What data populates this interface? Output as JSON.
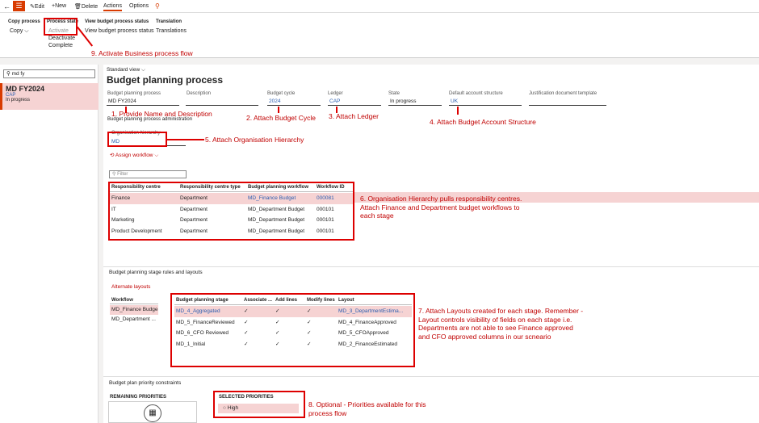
{
  "toolbar": {
    "edit": "Edit",
    "new": "New",
    "delete": "Delete",
    "actions": "Actions",
    "options": "Options"
  },
  "ribbon": {
    "copy_group": "Copy process",
    "copy": "Copy",
    "process_group": "Process state",
    "activate": "Activate",
    "deactivate": "Deactivate",
    "complete": "Complete",
    "view_group": "View budget process status",
    "view_item": "View budget process status",
    "translation_group": "Translation",
    "translations": "Translations"
  },
  "left": {
    "search_value": "md fy",
    "item_title": "MD FY2024",
    "item_sub": "CAP",
    "item_status": "In progress"
  },
  "header": {
    "view": "Standard view",
    "title": "Budget planning process"
  },
  "fields": {
    "process_lbl": "Budget planning process",
    "process_val": "MD FY2024",
    "desc_lbl": "Description",
    "cycle_lbl": "Budget cycle",
    "cycle_val": "2024",
    "ledger_lbl": "Ledger",
    "ledger_val": "CAP",
    "state_lbl": "State",
    "state_val": "In progress",
    "das_lbl": "Default account structure",
    "das_val": "UK",
    "jdt_lbl": "Justification document template"
  },
  "admin": {
    "section": "Budget planning process administration",
    "org_lbl": "Organisation hierarchy",
    "org_val": "MD",
    "assign": "Assign workflow",
    "filter": "Filter",
    "cols": [
      "Responsibility centre",
      "Responsibility centre type",
      "Budget planning workflow",
      "Workflow ID"
    ],
    "rows": [
      [
        "Finance",
        "Department",
        "MD_Finance Budget",
        "000081"
      ],
      [
        "IT",
        "Department",
        "MD_Department Budget",
        "000101"
      ],
      [
        "Marketing",
        "Department",
        "MD_Department Budget",
        "000101"
      ],
      [
        "Product Development",
        "Department",
        "MD_Department Budget",
        "000101"
      ]
    ]
  },
  "stages": {
    "section": "Budget planning stage rules and layouts",
    "alt": "Alternate layouts",
    "wf_col": "Workflow",
    "wf_rows": [
      "MD_Finance Budge",
      "MD_Department ..."
    ],
    "cols": [
      "Budget planning stage",
      "Associate ...",
      "Add lines",
      "Modify lines",
      "Layout"
    ],
    "rows": [
      [
        "MD_4_Aggregated",
        "✓",
        "✓",
        "✓",
        "MD_3_DepartmentEstima..."
      ],
      [
        "MD_5_FinanceReviewed",
        "✓",
        "✓",
        "✓",
        "MD_4_FinanceApproved"
      ],
      [
        "MD_6_CFO Reviewed",
        "✓",
        "✓",
        "✓",
        "MD_5_CFOApproved"
      ],
      [
        "MD_1_Initial",
        "✓",
        "✓",
        "✓",
        "MD_2_FinanceEstimated"
      ]
    ]
  },
  "priority": {
    "section": "Budget plan priority constraints",
    "remaining": "REMAINING PRIORITIES",
    "selected": "SELECTED PRIORITIES",
    "high": "High"
  },
  "annotations": {
    "a1": "1. Provide Name and Description",
    "a2": "2. Attach Budget Cycle",
    "a3": "3. Attach Ledger",
    "a4": "4. Attach Budget Account Structure",
    "a5": "5. Attach Organisation Hierarchy",
    "a6": "6. Organisation Hierarchy pulls responsibility centres.\nAttach Finance and Department budget workflows to\neach stage",
    "a7": "7. Attach Layouts created for each stage. Remember -\nLayout controls visibility of fields on each stage i.e.\nDepartments are not able to see Finance approved\nand CFO approved columns in our scneario",
    "a8": "8. Optional - Priorities available for this\nprocess flow",
    "a9": "9. Activate Business process flow"
  }
}
